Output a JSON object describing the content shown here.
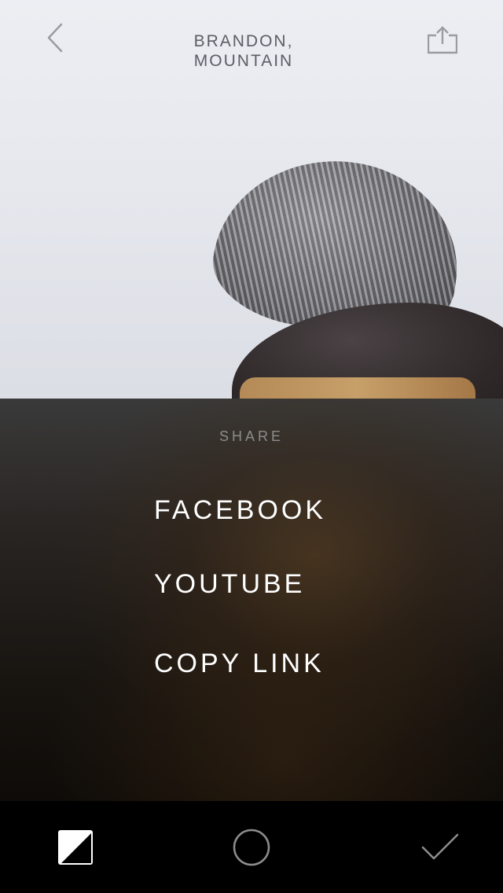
{
  "header": {
    "title_line1": "BRANDON,",
    "title_line2": "MOUNTAIN",
    "back_icon": "chevron-left-icon",
    "share_icon": "share-upload-icon"
  },
  "photo": {
    "subject": "person-wearing-knit-beanie"
  },
  "share_sheet": {
    "title": "SHARE",
    "options": [
      {
        "label": "FACEBOOK"
      },
      {
        "label": "YOUTUBE"
      },
      {
        "label": "COPY LINK"
      }
    ]
  },
  "toolbar": {
    "items": [
      {
        "icon": "contrast-filter-icon"
      },
      {
        "icon": "circle-icon"
      },
      {
        "icon": "checkmark-icon"
      }
    ]
  },
  "colors": {
    "header_text": "#5b5e66",
    "sheet_title": "#8c8c8c",
    "option_text": "#ffffff",
    "toolbar_bg": "#000000"
  }
}
